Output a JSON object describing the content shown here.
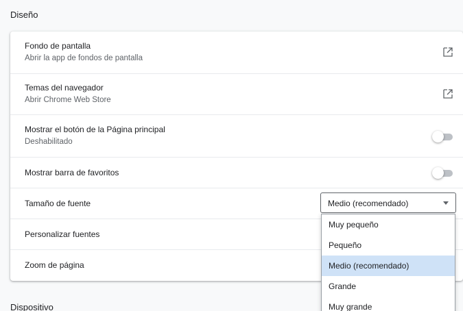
{
  "sections": {
    "appearance_title": "Diseño",
    "device_title": "Dispositivo"
  },
  "rows": {
    "wallpaper": {
      "title": "Fondo de pantalla",
      "subtitle": "Abrir la app de fondos de pantalla",
      "icon": "open-in-new-icon"
    },
    "themes": {
      "title": "Temas del navegador",
      "subtitle": "Abrir Chrome Web Store",
      "icon": "open-in-new-icon"
    },
    "home_button": {
      "title": "Mostrar el botón de la Página principal",
      "subtitle": "Deshabilitado",
      "toggle_on": false
    },
    "bookmarks_bar": {
      "title": "Mostrar barra de favoritos",
      "toggle_on": false
    },
    "font_size": {
      "title": "Tamaño de fuente",
      "selected": "Medio (recomendado)"
    },
    "customize_fonts": {
      "title": "Personalizar fuentes"
    },
    "page_zoom": {
      "title": "Zoom de página"
    }
  },
  "font_size_options": [
    "Muy pequeño",
    "Pequeño",
    "Medio (recomendado)",
    "Grande",
    "Muy grande"
  ],
  "colors": {
    "highlight": "#cfe2f7",
    "toggle_off_track": "#bdc1c6",
    "secondary_text": "#5f6368"
  }
}
